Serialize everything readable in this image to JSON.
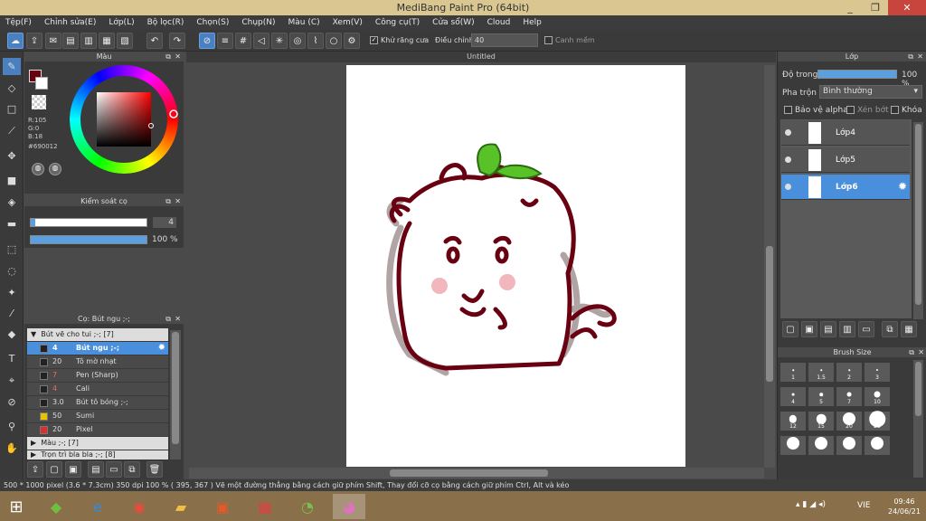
{
  "window": {
    "title": "MediBang Paint Pro (64bit)",
    "minimize": "_",
    "maximize": "❐",
    "close": "✕"
  },
  "menu": [
    "Tệp(F)",
    "Chỉnh sửa(E)",
    "Lớp(L)",
    "Bộ lọc(R)",
    "Chọn(S)",
    "Chụp(N)",
    "Màu (C)",
    "Xem(V)",
    "Công cụ(T)",
    "Cửa sổ(W)",
    "Cloud",
    "Help"
  ],
  "toolbar": {
    "antialias_label": "Khử răng cưa",
    "correction_label": "Điều chỉnh",
    "correction_value": "40",
    "edge_label": "Canh mềm"
  },
  "color_panel": {
    "title": "Màu",
    "r": "R:105",
    "g": "G:0",
    "b": "B:18",
    "hex": "#690012",
    "primary_color": "#690012"
  },
  "brush_control": {
    "title": "Kiểm soát cọ",
    "size": "4",
    "opacity": "100 %",
    "size_fraction": 0.04,
    "opacity_fraction": 1.0
  },
  "brush_list": {
    "title": "Cọ: Bút ngu ;-;",
    "group1": "Bút vẽ cho tui ;-; [7]",
    "items": [
      {
        "size": "4",
        "name": "Bút ngu ;-;",
        "color": "#222222",
        "selected": true
      },
      {
        "size": "20",
        "name": "Tô mờ nhạt",
        "color": "#222222",
        "selected": false
      },
      {
        "size": "7",
        "name": "Pen (Sharp)",
        "color": "#222222",
        "selected": false
      },
      {
        "size": "4",
        "name": "Cali",
        "color": "#222222",
        "selected": false
      },
      {
        "size": "3.0",
        "name": "Bút tô bóng ;-;",
        "color": "#222222",
        "selected": false
      },
      {
        "size": "50",
        "name": "Sumi",
        "color": "#e8c400",
        "selected": false
      },
      {
        "size": "20",
        "name": "Pixel",
        "color": "#d83030",
        "selected": false
      }
    ],
    "group2": "Màu ;-; [7]",
    "group3": "Trọn trì bla bla ;-; [8]"
  },
  "canvas": {
    "tab_title": "Untitled"
  },
  "layer_panel": {
    "title": "Lớp",
    "opacity_label": "Độ trong",
    "opacity_value": "100 %",
    "blend_label": "Pha trộn",
    "blend_value": "Bình thường",
    "protect_alpha": "Bảo vệ alpha",
    "clipping": "Xén bớt",
    "lock": "Khóa",
    "layers": [
      {
        "name": "Lớp4",
        "selected": false
      },
      {
        "name": "Lớp5",
        "selected": false
      },
      {
        "name": "Lớp6",
        "selected": true
      }
    ]
  },
  "brush_size_panel": {
    "title": "Brush Size",
    "sizes": [
      "1",
      "1.5",
      "2",
      "3",
      "4",
      "5",
      "7",
      "10",
      "12",
      "15",
      "20",
      "25",
      "",
      "",
      "",
      ""
    ]
  },
  "status": {
    "text": "500 * 1000 pixel   (3.6 * 7.3cm)   350 dpi   100 %   ( 395, 367 )   Vẽ một đường thẳng bằng cách giữ phím Shift, Thay đổi cỡ cọ bằng cách giữ phím Ctrl, Alt và kéo"
  },
  "taskbar": {
    "lang": "VIE",
    "time": "09:46",
    "date": "24/06/21"
  }
}
